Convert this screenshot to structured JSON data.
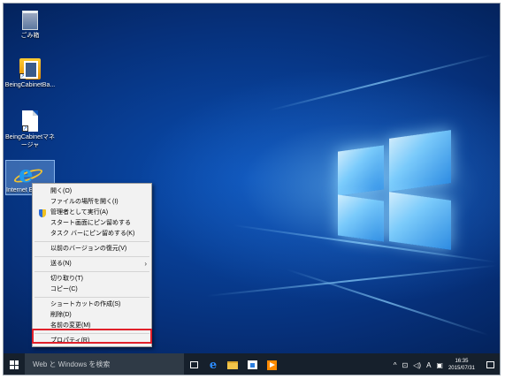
{
  "desktop": {
    "icons": [
      {
        "label": "ごみ箱"
      },
      {
        "label": "BeingCabinetBa..."
      },
      {
        "label": "BeingCabinetマネージャ"
      },
      {
        "label": "Internet E..."
      }
    ]
  },
  "context_menu": {
    "items": [
      {
        "label": "開く(O)"
      },
      {
        "label": "ファイルの場所を開く(I)"
      },
      {
        "label": "管理者として実行(A)"
      },
      {
        "label": "スタート画面にピン留めする"
      },
      {
        "label": "タスク バーにピン留めする(K)"
      },
      {
        "label": "以前のバージョンの復元(V)"
      },
      {
        "label": "送る(N)"
      },
      {
        "label": "切り取り(T)"
      },
      {
        "label": "コピー(C)"
      },
      {
        "label": "ショートカットの作成(S)"
      },
      {
        "label": "削除(D)"
      },
      {
        "label": "名前の変更(M)"
      },
      {
        "label": "プロパティ(R)"
      }
    ]
  },
  "taskbar": {
    "search_placeholder": "Web と Windows を検索",
    "ime_label": "A",
    "time": "16:35",
    "date": "2015/07/31"
  },
  "colors": {
    "highlight_border": "#e0202a",
    "taskbar_bg": "#16202c"
  }
}
